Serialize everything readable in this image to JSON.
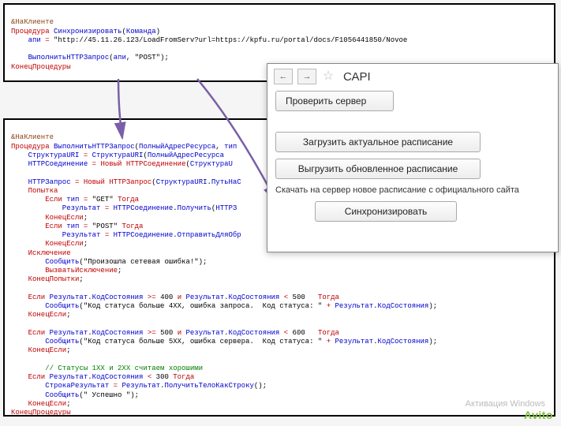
{
  "panel1": {
    "l1a": "&НаКлиенте",
    "l2a": "Процедура",
    "l2b": "Синхронизировать",
    "l2c": "(",
    "l2d": "Команда",
    "l2e": ")",
    "l3a": "    апи",
    "l3b": "=",
    "l3c": "\"http://45.11.26.123/LoadFromServ?url=https://kpfu.ru/portal/docs/F1056441850/Novoe",
    "l5a": "    ВыполнитьHTTPЗапрос",
    "l5b": "(",
    "l5c": "апи",
    "l5d": ",",
    "l5e": "\"POST\"",
    "l5f": ");",
    "l6a": "КонецПроцедуры"
  },
  "panel2": {
    "l1": "&НаКлиенте",
    "l2a": "Процедура",
    "l2b": "ВыполнитьHTTPЗапрос",
    "l2c": "(",
    "l2d": "ПолныйАдресРесурса",
    "l2e": ",",
    "l2f": "тип",
    "l3a": "    СтруктураURI",
    "l3b": "=",
    "l3c": "СтруктураURI",
    "l3d": "(",
    "l3e": "ПолныйАдресРесурса",
    "l4a": "    HTTPСоединение",
    "l4b": "=",
    "l4c": "Новый",
    "l4d": "HTTPСоединение",
    "l4e": "(",
    "l4f": "СтруктураU",
    "l6a": "    HTTPЗапрос",
    "l6b": "=",
    "l6c": "Новый",
    "l6d": "HTTPЗапрос",
    "l6e": "(",
    "l6f": "СтруктураURI",
    "l6g": ".",
    "l6h": "ПутьНаС",
    "l7a": "    Попытка",
    "l8a": "        Если",
    "l8b": "тип",
    "l8c": "=",
    "l8d": "\"GET\"",
    "l8e": "Тогда",
    "l9a": "            Результат",
    "l9b": "=",
    "l9c": "HTTPСоединение",
    "l9d": ".",
    "l9e": "Получить",
    "l9f": "(",
    "l9g": "HTTPЗ",
    "l10a": "        КонецЕсли",
    "l10b": ";",
    "l11a": "        Если",
    "l11b": "тип",
    "l11c": "=",
    "l11d": "\"POST\"",
    "l11e": "Тогда",
    "l12a": "            Результат",
    "l12b": "=",
    "l12c": "HTTPСоединение",
    "l12d": ".",
    "l12e": "ОтправитьДляОбр",
    "l13a": "        КонецЕсли",
    "l13b": ";",
    "l14a": "    Исключение",
    "l15a": "        Сообщить",
    "l15b": "(",
    "l15c": "\"Произошла сетевая ошибка!\"",
    "l15d": ");",
    "l16a": "        ВызватьИсключение",
    "l16b": ";",
    "l17a": "    КонецПопытки",
    "l17b": ";",
    "l19a": "    Если",
    "l19b": "Результат",
    "l19c": ".",
    "l19d": "КодСостояния",
    "l19e": ">=",
    "l19f": "400",
    "l19g": "и",
    "l19h": "Результат",
    "l19i": ".",
    "l19j": "КодСостояния",
    "l19k": "<",
    "l19l": "500",
    "l19m": "Тогда",
    "l20a": "        Сообщить",
    "l20b": "(",
    "l20c": "\"Код статуса больше 4XX, ошибка запроса.  Код статуса: \"",
    "l20d": "+",
    "l20e": "Результат",
    "l20f": ".",
    "l20g": "КодСостояния",
    "l20h": ");",
    "l21a": "    КонецЕсли",
    "l21b": ";",
    "l23a": "    Если",
    "l23b": "Результат",
    "l23c": ".",
    "l23d": "КодСостояния",
    "l23e": ">=",
    "l23f": "500",
    "l23g": "и",
    "l23h": "Результат",
    "l23i": ".",
    "l23j": "КодСостояния",
    "l23k": "<",
    "l23l": "600",
    "l23m": "Тогда",
    "l24a": "        Сообщить",
    "l24b": "(",
    "l24c": "\"Код статуса больше 5XX, ошибка сервера.  Код статуса: \"",
    "l24d": "+",
    "l24e": "Результат",
    "l24f": ".",
    "l24g": "КодСостояния",
    "l24h": ");",
    "l25a": "    КонецЕсли",
    "l25b": ";",
    "l27a": "        // Статусы 1XX и 2XX считаем хорошими",
    "l28a": "    Если",
    "l28b": "Результат",
    "l28c": ".",
    "l28d": "КодСостояния",
    "l28e": "<",
    "l28f": "300",
    "l28g": "Тогда",
    "l29a": "        СтрокаРезультат",
    "l29b": "=",
    "l29c": "Результат",
    "l29d": ".",
    "l29e": "ПолучитьТелоКакСтроку",
    "l29f": "();",
    "l30a": "        Сообщить",
    "l30b": "(",
    "l30c": "\" Успешно \"",
    "l30d": ");",
    "l31a": "    КонецЕсли",
    "l31b": ";",
    "l32a": "КонецПроцедуры"
  },
  "dialog": {
    "title": "САРІ",
    "btn_back": "←",
    "btn_fwd": "→",
    "star": "☆",
    "check_server": "Проверить сервер",
    "load_schedule": "Загрузить актуальное расписание",
    "unload_schedule": "Выгрузить обновленное расписание",
    "hint": "Скачать на сервер новое расписание с официального сайта",
    "sync": "Синхронизировать"
  },
  "watermark1": "Активация Windows",
  "watermark2": "Avito"
}
